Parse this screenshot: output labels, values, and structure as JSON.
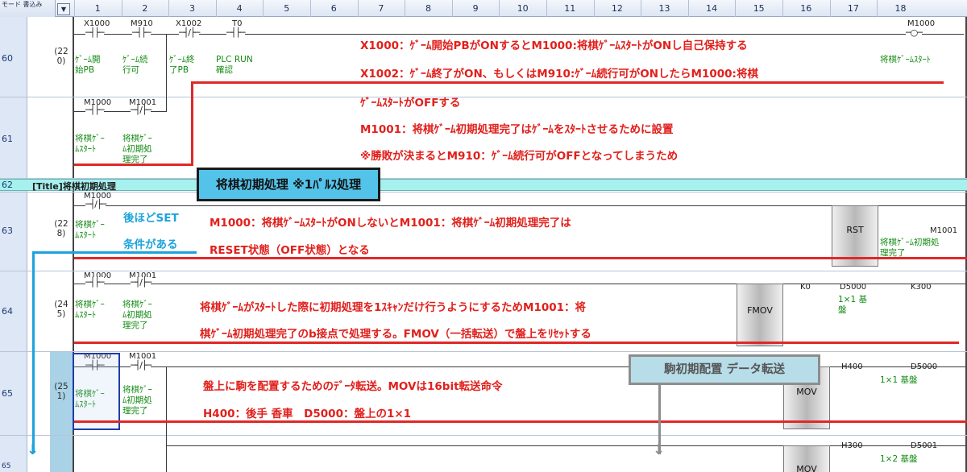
{
  "header": {
    "corner_label": "モード 書込み",
    "filter_icon": "filter-dropdown-icon",
    "columns": [
      "1",
      "2",
      "3",
      "4",
      "5",
      "6",
      "7",
      "8",
      "9",
      "10",
      "11",
      "12",
      "13",
      "14",
      "15",
      "16",
      "17",
      "18"
    ]
  },
  "title_row": {
    "step": "62",
    "text": "[Title]将棋初期処理"
  },
  "rows": {
    "r60": {
      "step": "60",
      "stepnum": "(22\n0)",
      "dev1": "X1000",
      "dev2": "M910",
      "dev3": "X1002",
      "dev4": "T0",
      "coil": "M1000",
      "c1": "ｹﾞｰﾑ開\n始PB",
      "c2": "ｹﾞｰﾑ続\n行可",
      "c3": "ｹﾞｰﾑ終\n了PB",
      "c4": "PLC RUN\n確認",
      "coil_cmt": "将棋ｹﾞｰﾑｽﾀｰﾄ"
    },
    "r61": {
      "step": "61",
      "dev1": "M1000",
      "dev2": "M1001",
      "c1": "将棋ｹﾞｰ\nﾑｽﾀｰﾄ",
      "c2": "将棋ｹﾞｰ\nﾑ初期処\n理完了"
    },
    "r63": {
      "step": "63",
      "stepnum": "(22\n8)",
      "dev1": "M1000",
      "c1": "将棋ｹﾞｰ\nﾑｽﾀｰﾄ",
      "instr": "RST",
      "target": "M1001",
      "target_cmt": "将棋ｹﾞｰﾑ初期処\n理完了"
    },
    "r64": {
      "step": "64",
      "stepnum": "(24\n5)",
      "dev1": "M1000",
      "dev2": "M1001",
      "c1": "将棋ｹﾞｰ\nﾑｽﾀｰﾄ",
      "c2": "将棋ｹﾞｰ\nﾑ初期処\n理完了",
      "instr": "FMOV",
      "op1": "K0",
      "op2": "D5000",
      "op3": "K300",
      "op2_cmt": "1×1 基\n盤"
    },
    "r65": {
      "step": "65",
      "stepnum": "(25\n1)",
      "dev1": "M1000",
      "dev2": "M1001",
      "c1": "将棋ｹﾞｰ\nﾑｽﾀｰﾄ",
      "c2": "将棋ｹﾞｰ\nﾑ初期処\n理完了",
      "instr": "MOV",
      "op1": "H400",
      "op2": "D5000",
      "op2_cmt": "1×1 基盤"
    },
    "r66": {
      "step": "65",
      "instr": "MOV",
      "op1": "H300",
      "op2": "D5001",
      "op2_cmt": "1×2 基盤"
    }
  },
  "notes": {
    "n60a": "X1000：ｹﾞｰﾑ開始PBがONするとM1000:将棋ｹﾞｰﾑｽﾀｰﾄがONし自己保持する",
    "n60b": "X1002：ｹﾞｰﾑ終了がON、もしくはM910:ｹﾞｰﾑ続行可がONしたらM1000:将棋",
    "n61a": "ｹﾞｰﾑｽﾀｰﾄがOFFする",
    "n61b": "M1001：将棋ｹﾞｰﾑ初期処理完了はｹﾞｰﾑをｽﾀｰﾄさせるために設置",
    "n61c": "※勝敗が決まるとM910：ｹﾞｰﾑ続行可がOFFとなってしまうため",
    "n63a": "M1000：将棋ｹﾞｰﾑｽﾀｰﾄがONしないとM1001：将棋ｹﾞｰﾑ初期処理完了は",
    "n63b": "RESET状態（OFF状態）となる",
    "n64a": "将棋ｹﾞｰﾑがｽﾀｰﾄした際に初期処理を1ｽｷｬﾝだけ行うようにするためM1001：将",
    "n64b": "棋ｹﾞｰﾑ初期処理完了のb接点で処理する。FMOV（一括転送）で盤上をﾘｾｯﾄする",
    "n65a": "盤上に駒を配置するためのﾃﾞｰﾀ転送。MOVは16bit転送命令",
    "n65b": "H400：後手 香車　D5000：盤上の1×1",
    "blue1": "後ほどSET",
    "blue2": "条件がある",
    "callout1": "将棋初期処理 ※1ﾊﾟﾙｽ処理",
    "callout2": "駒初期配置 データ転送"
  },
  "colors": {
    "red": "#e1201c",
    "blue": "#1da3dc",
    "comment_green": "#128a12",
    "title_bg": "#a6f0ee"
  }
}
